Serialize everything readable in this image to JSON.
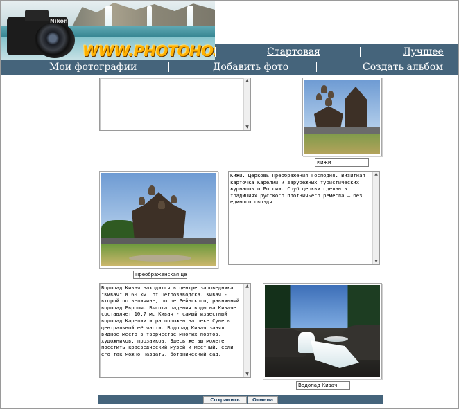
{
  "site": {
    "logo_text": "WWW.PHOTOHOST.RU",
    "camera_brand": "Nikon"
  },
  "nav": {
    "start": "Стартовая",
    "best": "Лучшее",
    "my_photos": "Мои фотографии",
    "add_photo": "Добавить фото",
    "create_album": "Создать альбом"
  },
  "entries": [
    {
      "description": "",
      "title": "Кижи"
    },
    {
      "description": "Кижи. Церковь Преображения Господня. Визитная карточка Карелии и зарубежных туристических журналов о России. Сруб церкви сделан в традициях русского плотничьего ремесла — без единого гвоздя",
      "title": "Преображенская церк"
    },
    {
      "description": "Водопад Кивач находится в центре заповедника \"Кивач\" в 60 км. от Петрозаводска. Кивач - второй по величине, после Рейнского, равнинный водопад Европы. Высота падения воды на Киваче составляет 10,7 м. Кивач - самый известный водопад Карелии и расположен на реке Суне в центральной  её части. Водопад Кивач занял видное место в творчестве многих поэтов, художников, прозаиков. Здесь же вы можете посетить краеведческий музей и местный, если его так можно назвать, ботанический сад.",
      "title": "Водопад Кивач"
    }
  ],
  "buttons": {
    "save": "Сохранить",
    "cancel": "Отмена"
  },
  "colors": {
    "nav_bg": "#45647b",
    "logo": "#ffb000"
  }
}
